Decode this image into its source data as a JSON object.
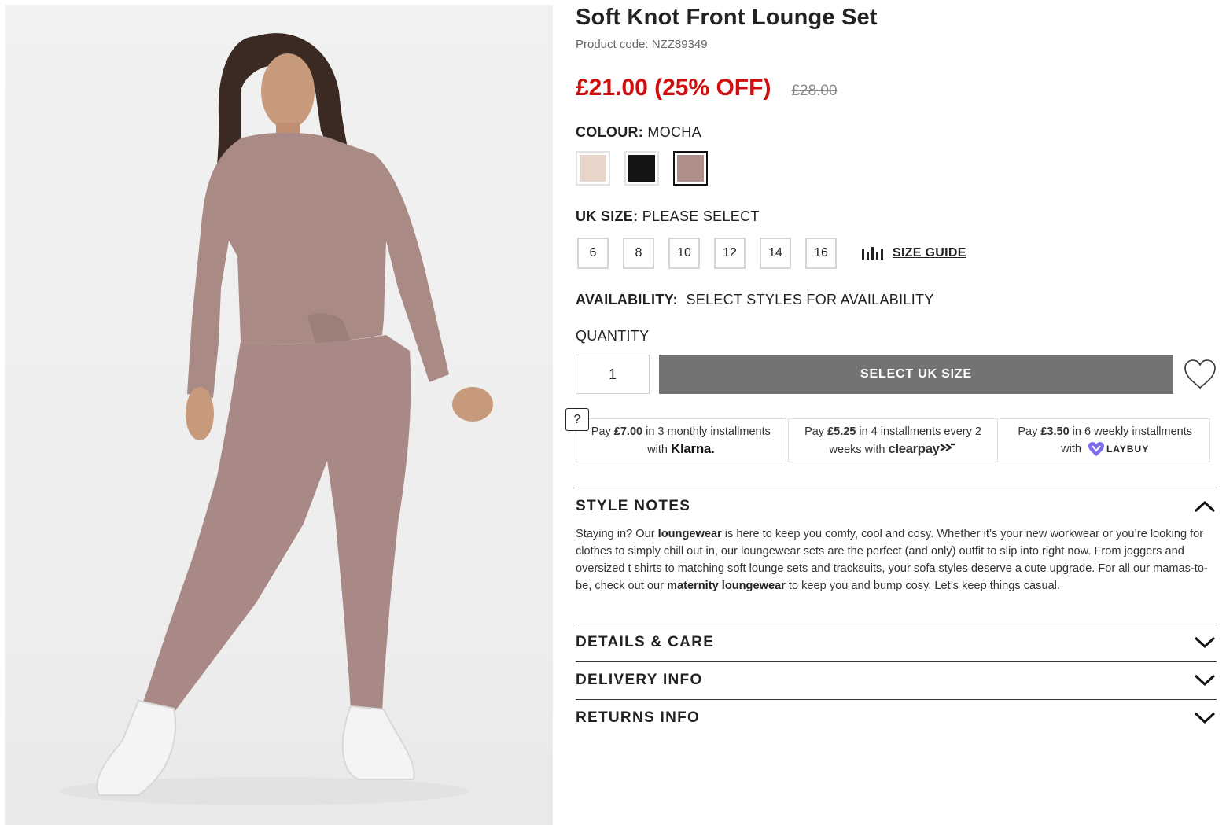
{
  "product": {
    "title": "Soft Knot Front Lounge Set",
    "code": "Product code: NZZ89349",
    "price_now": "£21.00 (25% OFF)",
    "price_was": "£28.00"
  },
  "colour": {
    "label": "COLOUR:",
    "value": "MOCHA",
    "swatches": [
      {
        "name": "Stone",
        "color": "#e7d6c9"
      },
      {
        "name": "Black",
        "color": "#141414"
      },
      {
        "name": "Mocha",
        "color": "#ad8e89",
        "selected": true
      }
    ]
  },
  "size": {
    "label": "UK SIZE:",
    "value": "PLEASE SELECT",
    "options": [
      "6",
      "8",
      "10",
      "12",
      "14",
      "16"
    ],
    "guide": "SIZE GUIDE"
  },
  "availability": {
    "label": "AVAILABILITY:",
    "value": "SELECT STYLES FOR AVAILABILITY"
  },
  "quantity": {
    "label": "QUANTITY",
    "value": "1"
  },
  "cta": "SELECT UK SIZE",
  "payments": {
    "help": "?",
    "klarna": {
      "pre": "Pay ",
      "amount": "£7.00",
      "post": " in 3 monthly installments with ",
      "brand": "Klarna."
    },
    "clearpay": {
      "pre": "Pay ",
      "amount": "£5.25",
      "post": " in 4 installments every 2 weeks with ",
      "brand": "clearpay"
    },
    "laybuy": {
      "pre": "Pay ",
      "amount": "£3.50",
      "post": " in 6 weekly installments with ",
      "brand": "LAYBUY"
    }
  },
  "accordion": {
    "style_notes": {
      "title": "STYLE NOTES",
      "t1": "Staying in? Our ",
      "b1": "loungewear",
      "t2": " is here to keep you comfy, cool and cosy. Whether it’s your new workwear or you’re looking for clothes to simply chill out in, our loungewear sets are the perfect (and only) outfit to slip into right now. From joggers and oversized t shirts to matching soft lounge sets and tracksuits, your sofa styles deserve a cute upgrade. For all our mamas-to-be, check out our ",
      "b2": "maternity loungewear",
      "t3": " to keep you and bump cosy. Let’s keep things casual."
    },
    "details": "DETAILS & CARE",
    "delivery": "DELIVERY INFO",
    "returns": "RETURNS INFO"
  },
  "colors": {
    "price_red": "#d10d0d",
    "cta_grey": "#737373",
    "laybuy_purple": "#7c6cf0"
  }
}
